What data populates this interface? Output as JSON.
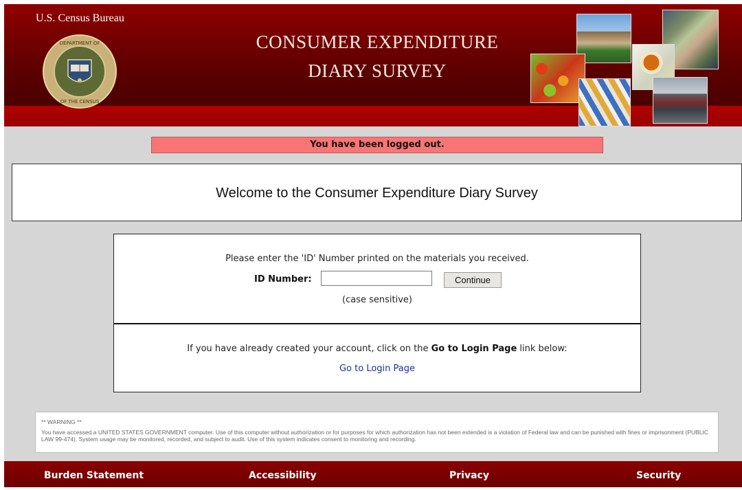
{
  "header": {
    "agency": "U.S. Census Bureau",
    "title_line1": "CONSUMER EXPENDITURE",
    "title_line2": "DIARY SURVEY",
    "seal_text_top": "U.S. DEPARTMENT OF COMMERCE",
    "seal_text_bottom": "BUREAU OF THE CENSUS"
  },
  "alert": {
    "message": "You have been logged out."
  },
  "welcome": {
    "text": "Welcome to the Consumer Expenditure Diary Survey"
  },
  "id_form": {
    "prompt": "Please enter the 'ID' Number printed on the materials you received.",
    "label": "ID Number:",
    "value": "",
    "button": "Continue",
    "hint": "(case sensitive)"
  },
  "login_section": {
    "text_before": "If you have already created your account, click on the ",
    "text_bold": "Go to Login Page",
    "text_after": " link below:",
    "link": "Go to Login Page"
  },
  "warning": {
    "title": "** WARNING **",
    "body": "You have accessed a UNITED STATES GOVERNMENT computer. Use of this computer without authorization or for purposes for which authorization has not been extended is a violation of Federal law and can be punished with fines or imprisonment (PUBLIC LAW 99-474). System usage may be monitored, recorded, and subject to audit. Use of this system indicates consent to monitoring and recording."
  },
  "footer": {
    "links": [
      "Burden Statement",
      "Accessibility",
      "Privacy",
      "Security"
    ]
  },
  "colors": {
    "header_red": "#7a0000",
    "alert_bg": "#f97575",
    "page_gray": "#d6d6d6",
    "link_blue": "#1a2fa0"
  },
  "icons": {
    "seal": "census-bureau-seal",
    "photos": [
      "house-photo",
      "money-photo",
      "fruit-photo",
      "pills-photo",
      "clothing-photo",
      "car-photo"
    ]
  }
}
